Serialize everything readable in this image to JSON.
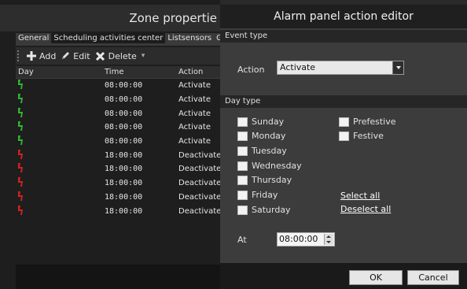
{
  "zone": {
    "title": "Zone propertie",
    "tabs": [
      "General",
      "Scheduling activities center",
      "Listsensors",
      "Gr"
    ],
    "active_tab": 1,
    "toolbar": {
      "add": "Add",
      "edit": "Edit",
      "delete": "Delete"
    },
    "columns": [
      "Day",
      "Time",
      "Action"
    ],
    "rows": [
      {
        "time": "08:00:00",
        "action": "Activate"
      },
      {
        "time": "08:00:00",
        "action": "Activate"
      },
      {
        "time": "08:00:00",
        "action": "Activate"
      },
      {
        "time": "08:00:00",
        "action": "Activate"
      },
      {
        "time": "08:00:00",
        "action": "Activate"
      },
      {
        "time": "18:00:00",
        "action": "Deactivate"
      },
      {
        "time": "18:00:00",
        "action": "Deactivate"
      },
      {
        "time": "18:00:00",
        "action": "Deactivate"
      },
      {
        "time": "18:00:00",
        "action": "Deactivate"
      },
      {
        "time": "18:00:00",
        "action": "Deactivate"
      }
    ]
  },
  "dialog": {
    "title": "Alarm panel action editor",
    "event_type_header": "Event type",
    "action_label": "Action",
    "action_value": "Activate",
    "day_type_header": "Day type",
    "days": [
      "Sunday",
      "Monday",
      "Tuesday",
      "Wednesday",
      "Thursday",
      "Friday",
      "Saturday"
    ],
    "special_days": [
      "Prefestive",
      "Festive"
    ],
    "select_all": "Select all",
    "deselect_all": "Deselect all",
    "at_label": "At",
    "at_value": "08:00:00",
    "ok": "OK",
    "cancel": "Cancel"
  },
  "colors": {
    "activate_icon": "#33b533",
    "deactivate_icon": "#d42020"
  }
}
